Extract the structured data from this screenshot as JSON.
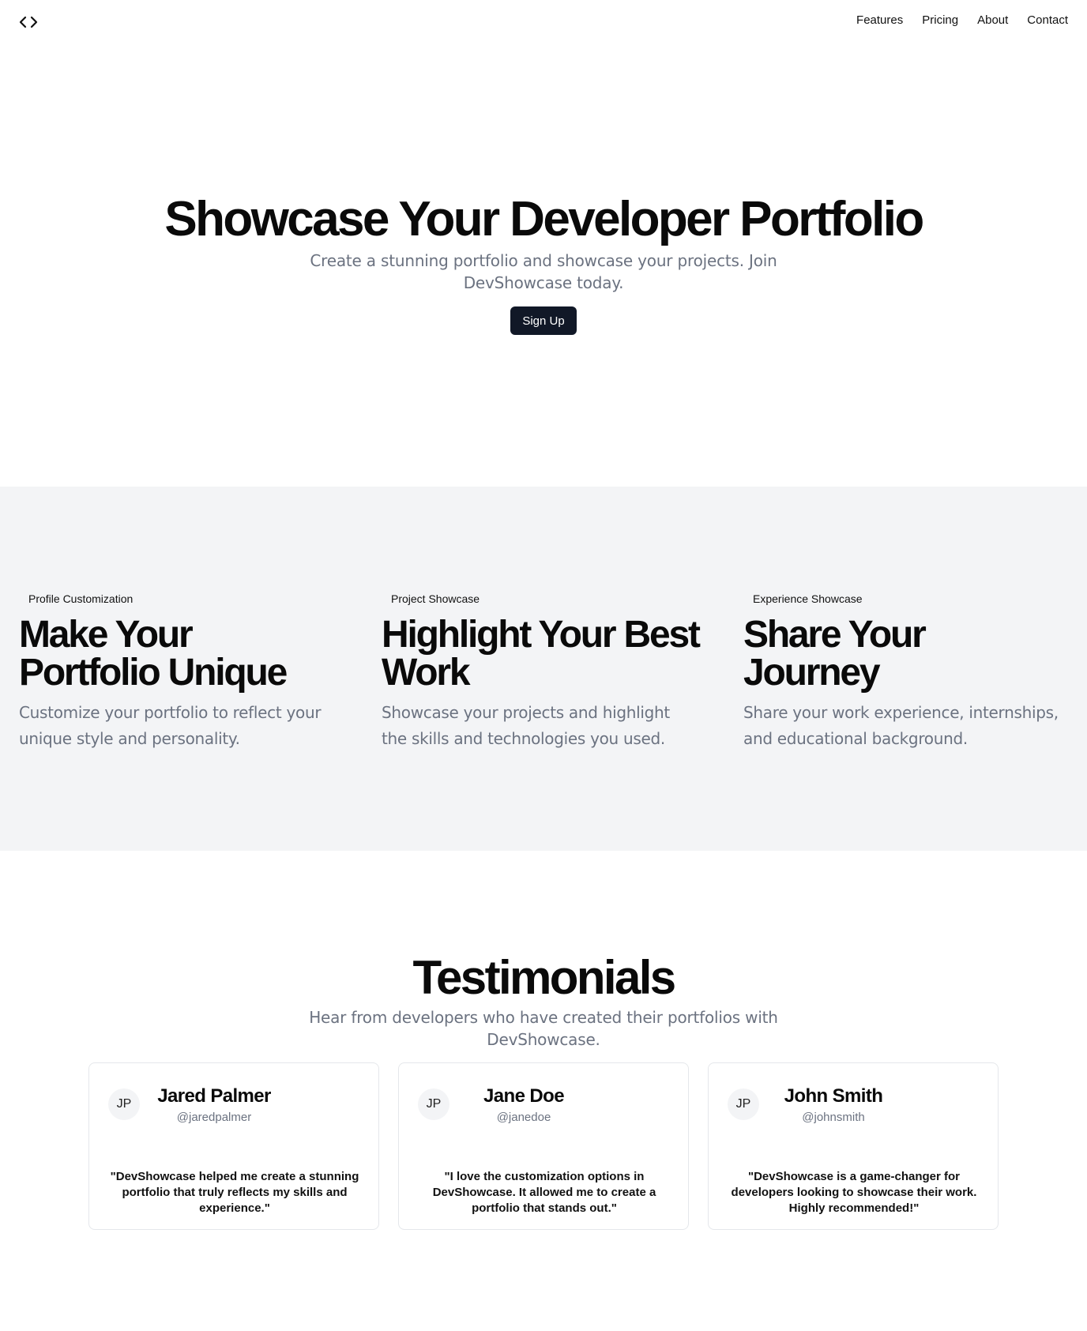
{
  "header": {
    "logo_icon": "code-icon",
    "nav": [
      "Features",
      "Pricing",
      "About",
      "Contact"
    ]
  },
  "hero": {
    "title": "Showcase Your Developer Portfolio",
    "subtitle": "Create a stunning portfolio and showcase your projects. Join DevShowcase today.",
    "cta": "Sign Up"
  },
  "features": [
    {
      "tag": "Profile Customization",
      "title": "Make Your Portfolio Unique",
      "description": "Customize your portfolio to reflect your unique style and personality."
    },
    {
      "tag": "Project Showcase",
      "title": "Highlight Your Best Work",
      "description": "Showcase your projects and highlight the skills and technologies you used."
    },
    {
      "tag": "Experience Showcase",
      "title": "Share Your Journey",
      "description": "Share your work experience, internships, and educational background."
    }
  ],
  "testimonials": {
    "title": "Testimonials",
    "subtitle": "Hear from developers who have created their portfolios with DevShowcase.",
    "items": [
      {
        "initials": "JP",
        "name": "Jared Palmer",
        "handle": "@jaredpalmer",
        "quote": "\"DevShowcase helped me create a stunning portfolio that truly reflects my skills and experience.\""
      },
      {
        "initials": "JP",
        "name": "Jane Doe",
        "handle": "@janedoe",
        "quote": "\"I love the customization options in DevShowcase. It allowed me to create a portfolio that stands out.\""
      },
      {
        "initials": "JP",
        "name": "John Smith",
        "handle": "@johnsmith",
        "quote": "\"DevShowcase is a game-changer for developers looking to showcase their work. Highly recommended!\""
      }
    ]
  },
  "colors": {
    "primary_button": "#111827",
    "muted_text": "#6b7280",
    "features_background": "#f3f4f6"
  }
}
